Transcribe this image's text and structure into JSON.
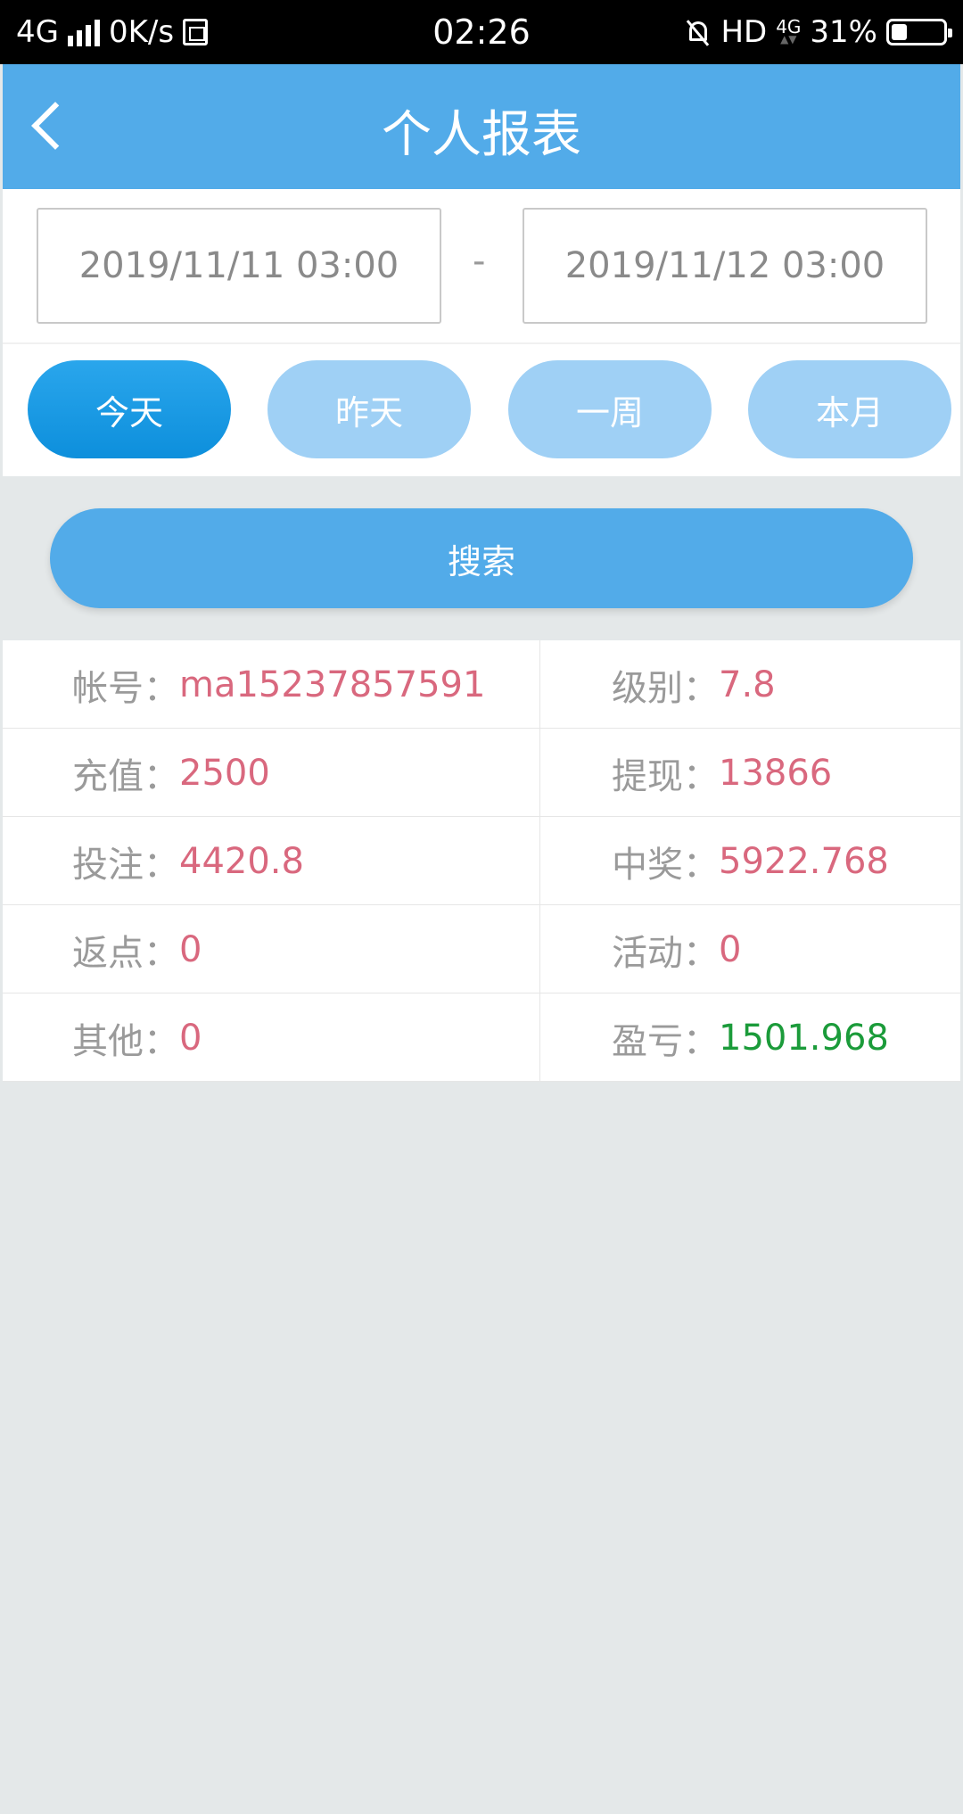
{
  "status_bar": {
    "network": "4G",
    "speed": "0K/s",
    "time": "02:26",
    "hd": "HD",
    "net_badge": "4G",
    "battery_text": "31%",
    "battery_level": 0.31
  },
  "header": {
    "title": "个人报表",
    "back_icon": "chevron-left-icon"
  },
  "date_range": {
    "start": "2019/11/11 03:00",
    "end": "2019/11/12 03:00",
    "separator": "-"
  },
  "quick_ranges": [
    {
      "label": "今天",
      "active": true
    },
    {
      "label": "昨天",
      "active": false
    },
    {
      "label": "一周",
      "active": false
    },
    {
      "label": "本月",
      "active": false
    }
  ],
  "search": {
    "label": "搜索"
  },
  "report": {
    "rows": [
      {
        "left_label": "帐号：",
        "left_value": "ma15237857591",
        "right_label": "级别：",
        "right_value": "7.8"
      },
      {
        "left_label": "充值：",
        "left_value": "2500",
        "right_label": "提现：",
        "right_value": "13866"
      },
      {
        "left_label": "投注：",
        "left_value": "4420.8",
        "right_label": "中奖：",
        "right_value": "5922.768"
      },
      {
        "left_label": "返点：",
        "left_value": "0",
        "right_label": "活动：",
        "right_value": "0"
      },
      {
        "left_label": "其他：",
        "left_value": "0",
        "right_label": "盈亏：",
        "right_value": "1501.968"
      }
    ]
  },
  "colors": {
    "header_blue": "#52abe9",
    "active_pill": "#0d8fdc",
    "inactive_pill": "#9fd0f5",
    "value_pink": "#d9687e",
    "profit_green": "#1b9b3a"
  }
}
